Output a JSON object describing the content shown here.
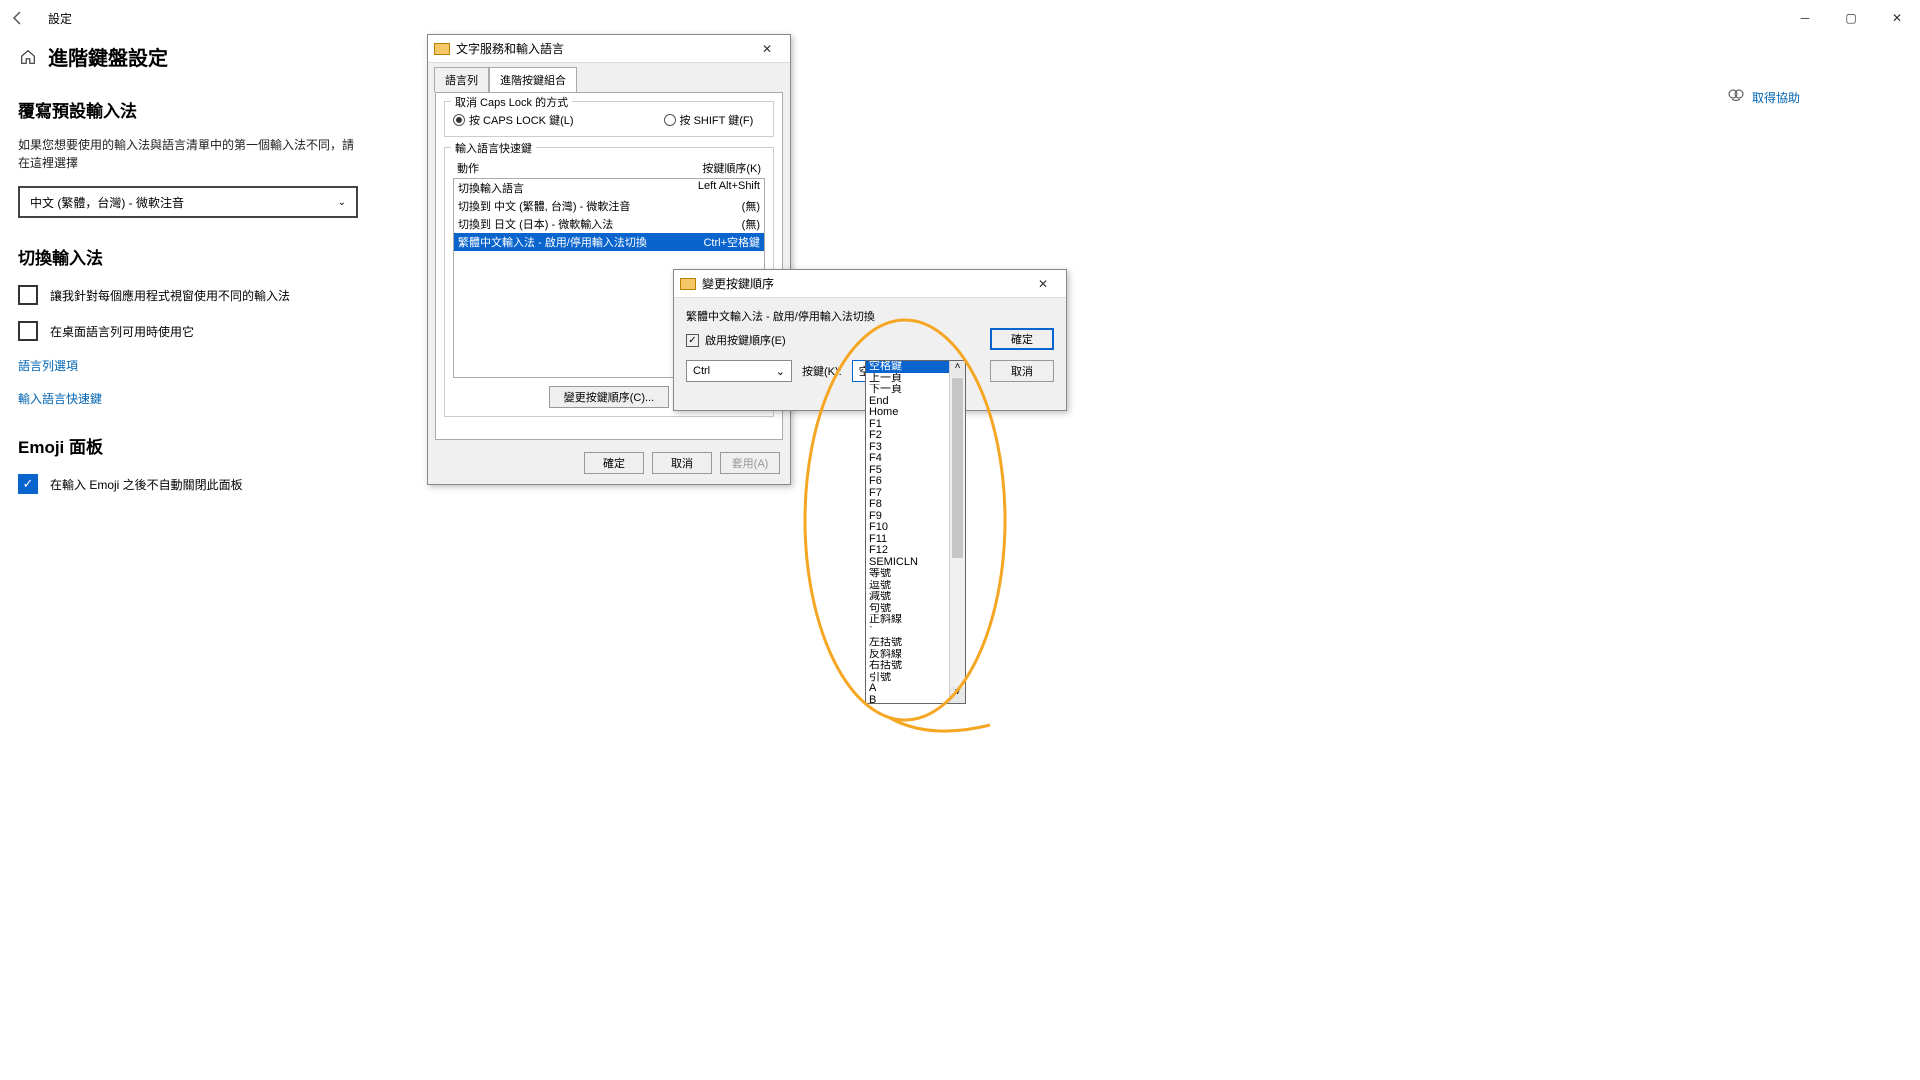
{
  "titlebar": {
    "title": "設定"
  },
  "page": {
    "title": "進階鍵盤設定"
  },
  "override": {
    "heading": "覆寫預設輸入法",
    "desc": "如果您想要使用的輸入法與語言清單中的第一個輸入法不同，請在這裡選擇",
    "value": "中文 (繁體，台灣) - 微軟注音"
  },
  "switch": {
    "heading": "切換輸入法",
    "chk1": "讓我針對每個應用程式視窗使用不同的輸入法",
    "chk2": "在桌面語言列可用時使用它",
    "link1": "語言列選項",
    "link2": "輸入語言快速鍵"
  },
  "emoji": {
    "heading": "Emoji 面板",
    "chk": "在輸入 Emoji 之後不自動關閉此面板"
  },
  "help": {
    "text": "取得協助"
  },
  "dlg1": {
    "title": "文字服務和輸入語言",
    "tabs": {
      "t1": "語言列",
      "t2": "進階按鍵組合"
    },
    "grp1": {
      "legend": "取消 Caps Lock 的方式",
      "r1": "按 CAPS LOCK 鍵(L)",
      "r2": "按 SHIFT 鍵(F)"
    },
    "grp2": {
      "legend": "輸入語言快速鍵",
      "h1": "動作",
      "h2": "按鍵順序(K)",
      "rows": [
        {
          "a": "切換輸入語言",
          "k": "Left Alt+Shift"
        },
        {
          "a": "切換到 中文 (繁體, 台灣) - 微軟注音",
          "k": "(無)"
        },
        {
          "a": "切換到 日文 (日本) - 微軟輸入法",
          "k": "(無)"
        },
        {
          "a": "繁體中文輸入法 - 啟用/停用輸入法切換",
          "k": "Ctrl+空格鍵"
        }
      ],
      "change": "變更按鍵順序(C)..."
    },
    "buttons": {
      "ok": "確定",
      "cancel": "取消",
      "apply": "套用(A)"
    }
  },
  "dlg2": {
    "title": "變更按鍵順序",
    "subtitle": "繁體中文輸入法 - 啟用/停用輸入法切換",
    "enable": "啟用按鍵順序(E)",
    "modifier": "Ctrl",
    "keyLabel": "按鍵(K):",
    "keyValue": "空格鍵",
    "ok": "確定",
    "cancel": "取消"
  },
  "dropdown": {
    "options": [
      "空格鍵",
      "上一頁",
      "下一頁",
      "End",
      "Home",
      "F1",
      "F2",
      "F3",
      "F4",
      "F5",
      "F6",
      "F7",
      "F8",
      "F9",
      "F10",
      "F11",
      "F12",
      "SEMICLN",
      "等號",
      "逗號",
      "減號",
      "句號",
      "正斜線",
      "`",
      "左括號",
      "反斜線",
      "右括號",
      "引號",
      "A",
      "B"
    ]
  }
}
